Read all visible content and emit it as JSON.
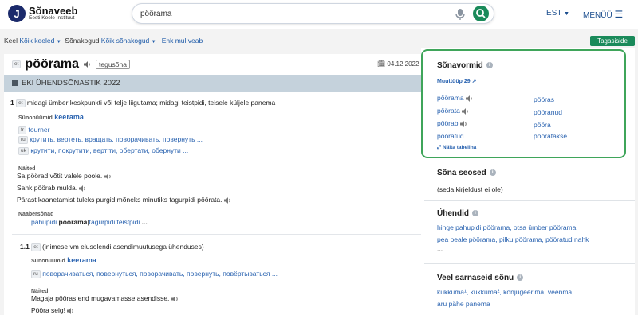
{
  "header": {
    "logo_title": "Sõnaveeb",
    "logo_sub": "Eesti Keele Instituut",
    "search_value": "pöörama",
    "lang": "EST",
    "menu": "MENÜÜ"
  },
  "filters": {
    "keel_label": "Keel",
    "keel_value": "Kõik keeled",
    "sonakogud_label": "Sõnakogud",
    "sonakogud_value": "Kõik sõnakogud",
    "report": "Ehk mul veab",
    "back_button": "Tagasiside"
  },
  "entry": {
    "lang_badge": "et",
    "word": "pöörama",
    "pos": "tegusõna",
    "date": "04.12.2022",
    "dictionary": "EKI ÜHENDSÕNASTIK 2022"
  },
  "sense1": {
    "num": "1",
    "lang": "et",
    "definition": "midagi ümber keskpunkti või telje liigutama;  midagi teistpidi, teisele küljele panema",
    "synonyms_label": "Sünonüümid",
    "synonym": "keerama",
    "trans": [
      {
        "lang": "fr",
        "text": "tourner"
      },
      {
        "lang": "ru",
        "text": "крутить, вертеть, вращать, поворачивать, повернуть ..."
      },
      {
        "lang": "uk",
        "text": "крутити, покрутити, вертiти, обертати, обернути ..."
      }
    ],
    "examples_label": "Näited",
    "examples": [
      "Sa pöörad võtit valele poole.",
      "Sahk pöörab mulda.",
      "Pärast kaanetamist tuleks purgid mõneks minutiks tagurpidi pöörata."
    ],
    "neighbours_label": "Naabersõnad",
    "neighbours": [
      "pahupidi",
      "pöörama",
      "tagurpidi",
      "teistpidi",
      "..."
    ]
  },
  "sense2": {
    "num": "1.1",
    "lang": "et",
    "definition": "(inimese vm elusolendi asendimuutusega ühenduses)",
    "synonyms_label": "Sünonüümid",
    "synonym": "keerama",
    "trans_lang": "ru",
    "trans": "поворачиваться, повернуться, поворачивать, повернуть, повёртываться ...",
    "examples_label": "Näited",
    "examples": [
      "Magaja pööras end mugavamasse asendisse.",
      "Pööra selg!"
    ]
  },
  "sidebar": {
    "forms_title": "Sõnavormid",
    "paradigm": "Muuttüüp 29",
    "forms_left": [
      "pöörama",
      "pöörata",
      "pöörab",
      "pööratud"
    ],
    "forms_right": [
      "pööras",
      "pööranud",
      "pöörа",
      "pööratakse"
    ],
    "show_table": "Näita tabelina",
    "relations_title": "Sõna seosed",
    "relations_text": "(seda kirjeldust ei ole)",
    "phrases_title": "Ühendid",
    "phrases_line1": "hinge pahupidi pöörama,  otsa ümber pöörama,",
    "phrases_line2": "pea peale pöörama,  pilku pöörama,  pööratud nahk",
    "phrases_more": "...",
    "similar_title": "Veel sarnaseid sõnu",
    "similar_line1": "kukkuma¹,  kukkuma²,  konjugeerima,  veenma,",
    "similar_line2": "aru pähe panema"
  }
}
